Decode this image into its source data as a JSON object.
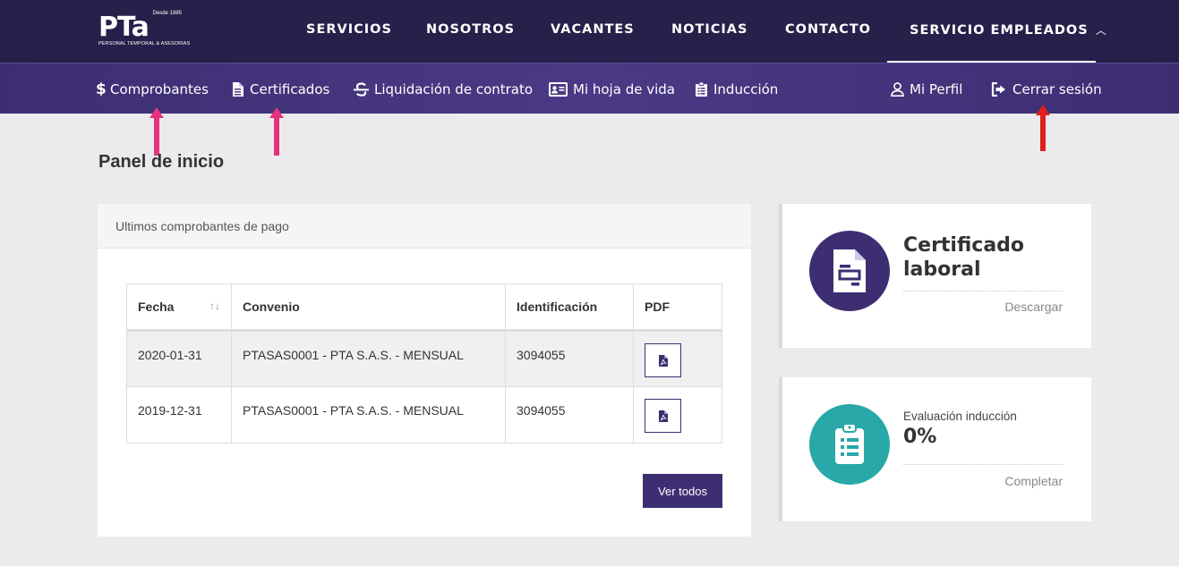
{
  "brand": {
    "logo_text": "PTa",
    "since": "Desde 1985",
    "tagline": "PERSONAL TEMPORAL & ASESORIAS"
  },
  "topnav": {
    "items": [
      "SERVICIOS",
      "NOSOTROS",
      "VACANTES",
      "NOTICIAS",
      "CONTACTO",
      "SERVICIO EMPLEADOS"
    ]
  },
  "subnav": {
    "comprobantes": "Comprobantes",
    "certificados": "Certificados",
    "liquidacion": "Liquidación de contrato",
    "hoja_vida": "Mi hoja de vida",
    "induccion": "Inducción",
    "perfil": "Mi Perfil",
    "cerrar": "Cerrar sesión"
  },
  "page": {
    "title": "Panel de inicio"
  },
  "payments": {
    "heading": "Ultimos comprobantes de pago",
    "columns": [
      "Fecha",
      "Convenio",
      "Identificación",
      "PDF"
    ],
    "rows": [
      {
        "fecha": "2020-01-31",
        "convenio": "PTASAS0001 - PTA S.A.S. - MENSUAL",
        "id": "3094055"
      },
      {
        "fecha": "2019-12-31",
        "convenio": "PTASAS0001 - PTA S.A.S. - MENSUAL",
        "id": "3094055"
      }
    ],
    "sort_glyph": "↑↓",
    "ver_todos": "Ver todos"
  },
  "cards": {
    "certificado": {
      "title_line1": "Certificado",
      "title_line2": "laboral",
      "link": "Descargar",
      "color": "#3d2e72"
    },
    "evaluacion": {
      "label": "Evaluación inducción",
      "value": "0%",
      "link": "Completar",
      "color": "#28a8a8"
    }
  },
  "colors": {
    "topbar": "#27204a",
    "subbar": "#4a3a85",
    "accent": "#3d2e72",
    "arrow_pink": "#e8327c",
    "arrow_red": "#e0201c"
  }
}
